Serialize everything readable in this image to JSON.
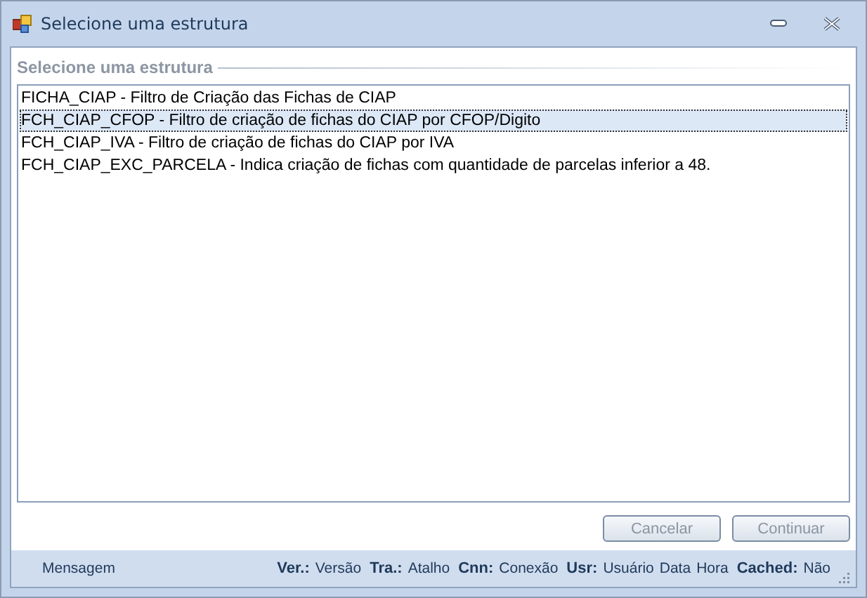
{
  "window": {
    "title": "Selecione uma estrutura"
  },
  "group": {
    "title": "Selecione uma estrutura"
  },
  "list": {
    "items": [
      {
        "label": "FICHA_CIAP - Filtro de Criação das Fichas de CIAP",
        "selected": false
      },
      {
        "label": "FCH_CIAP_CFOP - Filtro de criação de fichas do CIAP por CFOP/Digito",
        "selected": true
      },
      {
        "label": "FCH_CIAP_IVA - Filtro de criação de fichas do CIAP por IVA",
        "selected": false
      },
      {
        "label": "FCH_CIAP_EXC_PARCELA - Indica criação de fichas com quantidade de parcelas inferior a 48.",
        "selected": false
      }
    ]
  },
  "buttons": [
    {
      "label": "Cancelar",
      "disabled": true
    },
    {
      "label": "Continuar",
      "disabled": true
    }
  ],
  "status_bar": {
    "message": "Mensagem",
    "fields": [
      {
        "label": "Ver.:",
        "value": "Versão"
      },
      {
        "label": "Tra.:",
        "value": "Atalho"
      },
      {
        "label": "Cnn:",
        "value": "Conexão"
      },
      {
        "label": "Usr:",
        "value": "Usuário"
      },
      {
        "value": "Data"
      },
      {
        "value": "Hora"
      },
      {
        "label": "Cached:",
        "value": "Não"
      }
    ]
  }
}
